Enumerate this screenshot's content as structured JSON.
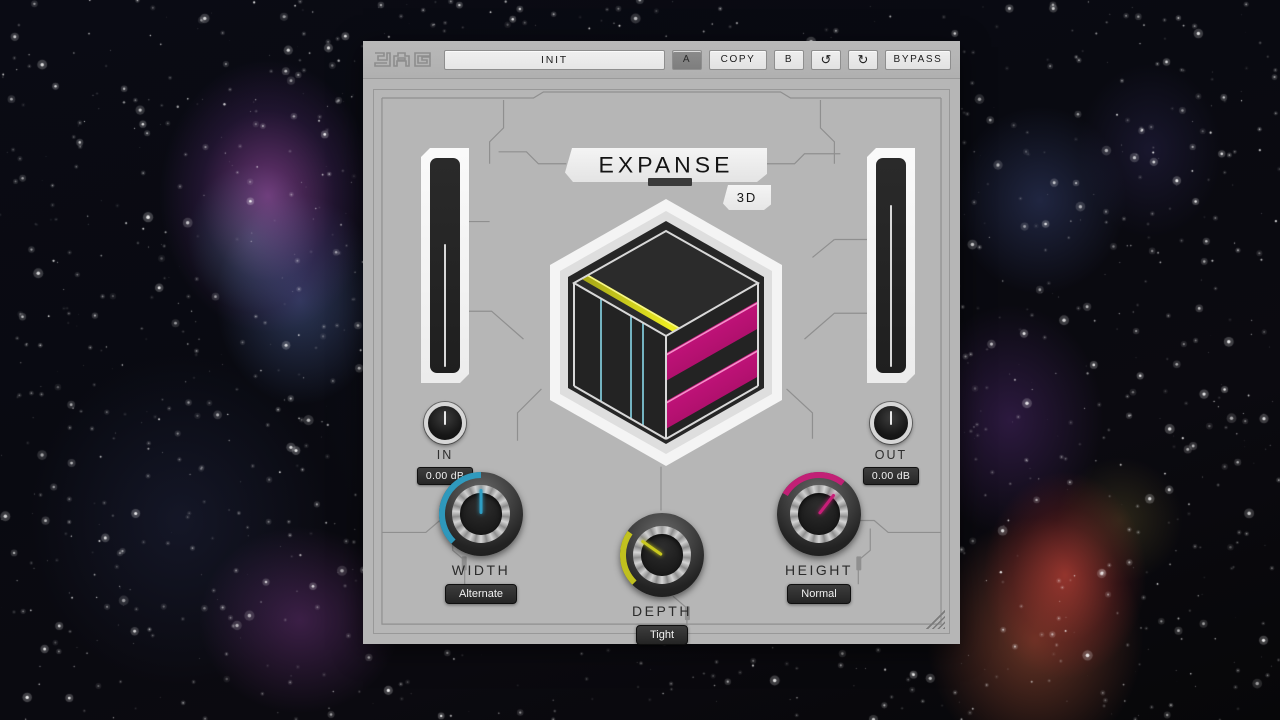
{
  "window": {
    "plugin_name": "EXPANSE",
    "plugin_badge": "3D",
    "brand_logo": "jag-logo"
  },
  "toolbar": {
    "preset_name": "INIT",
    "preset_placeholder": "INIT",
    "slot_a_label": "A",
    "copy_label": "COPY",
    "slot_b_label": "B",
    "undo_label": "↺",
    "redo_label": "↻",
    "bypass_label": "BYPASS",
    "active_slot": "A"
  },
  "meters": {
    "input": {
      "name": "input-meter",
      "level_pct": 61
    },
    "output": {
      "name": "output-meter",
      "level_pct": 79
    }
  },
  "io": {
    "input": {
      "label": "IN",
      "value": "0.00 dB",
      "angle": 0
    },
    "output": {
      "label": "OUT",
      "value": "0.00 dB",
      "angle": 0
    }
  },
  "knobs": [
    {
      "id": "width",
      "label": "WIDTH",
      "value": "Alternate",
      "color": "#2e9ec4",
      "angle": 0,
      "arc_start": -135,
      "arc_end": 0,
      "size": 84
    },
    {
      "id": "depth",
      "label": "DEPTH",
      "value": "Tight",
      "color": "#c8c81e",
      "angle": -55,
      "arc_start": -135,
      "arc_end": -55,
      "size": 84
    },
    {
      "id": "height",
      "label": "HEIGHT",
      "value": "Normal",
      "color": "#c81e78",
      "angle": 38,
      "arc_start": -60,
      "arc_end": 38,
      "size": 84
    }
  ],
  "cube": {
    "name": "expanse-3d-cube",
    "top_face_color": "#d6d617",
    "left_face_color": "#1fa3c8",
    "right_face_color": "#cf1580",
    "body_color": "#262626",
    "outline_color": "#f2f2f2"
  },
  "colors": {
    "panel_bg": "#b6b6b6",
    "accent_cyan": "#2e9ec4",
    "accent_yellow": "#c8c81e",
    "accent_magenta": "#c81e78",
    "text_dark": "#1c1c1c"
  }
}
